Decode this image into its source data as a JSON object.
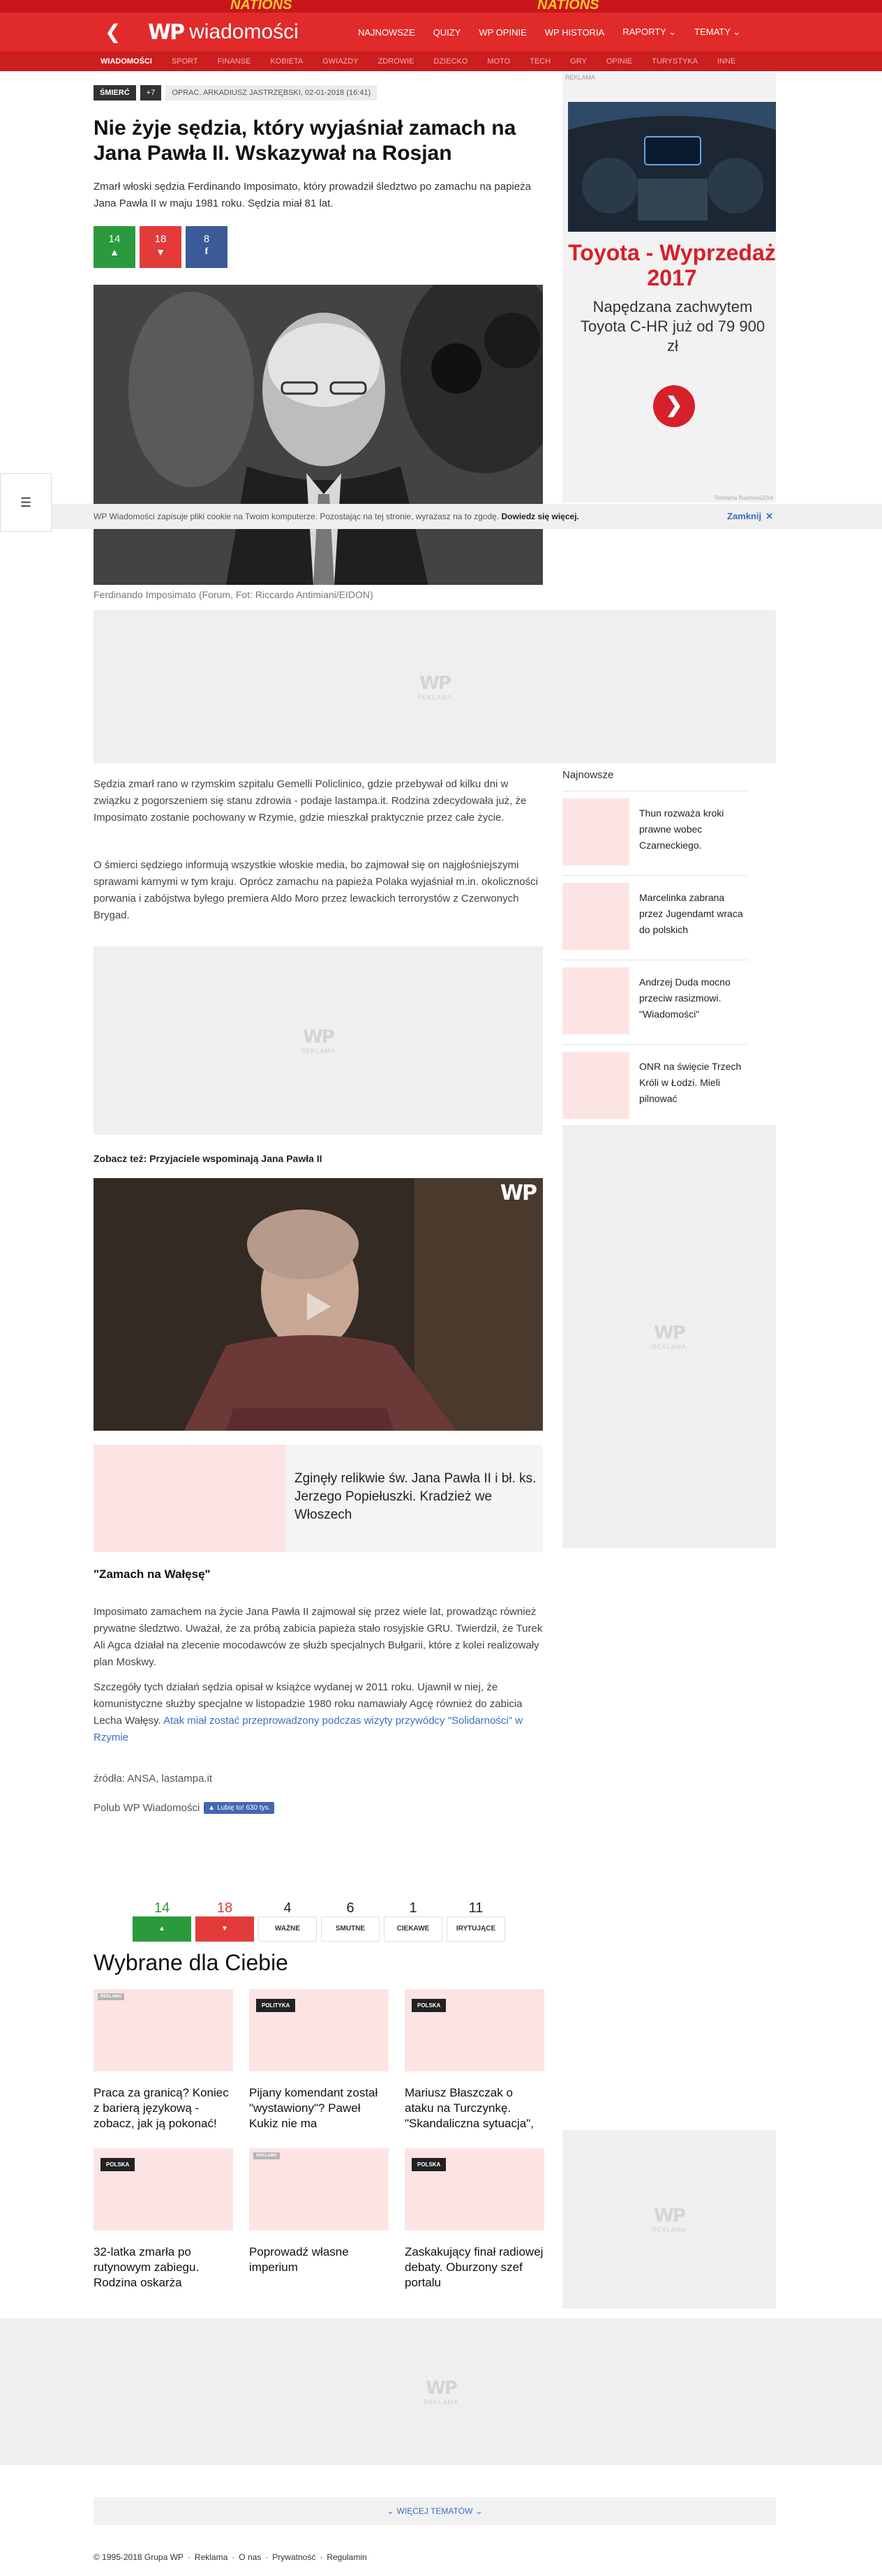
{
  "top_banner": {
    "text_1": "NATIONS",
    "text_2": "NATIONS"
  },
  "nav": {
    "logo_mark": "WP",
    "logo_text": "wiadomości",
    "links": [
      "NAJNOWSZE",
      "QUIZY",
      "WP OPINIE",
      "WP HISTORIA",
      "RAPORTY",
      "TEMATY"
    ]
  },
  "subnav": [
    "WIADOMOŚCI",
    "SPORT",
    "FINANSE",
    "KOBIETA",
    "GWIAZDY",
    "ZDROWIE",
    "DZIECKO",
    "MOTO",
    "TECH",
    "GRY",
    "OPINIE",
    "TURYSTYKA",
    "INNE"
  ],
  "article": {
    "tag": "ŚMIERĆ",
    "tag_more": "+7",
    "byline": "OPRAC. ARKADIUSZ JASTRZĘBSKI, 02-01-2018 (16:41)",
    "title": "Nie żyje sędzia, który wyjaśniał zamach na Jana Pawła II. Wskazywał na Rosjan",
    "lead": "Zmarł włoski sędzia Ferdinando Imposimato, który prowadził śledztwo po zamachu na papieża Jana Pawła II w maju 1981 roku. Sędzia miał 81 lat.",
    "votes": {
      "up": "14",
      "down": "18",
      "fb": "8"
    },
    "photo_caption": "Ferdinando Imposimato (Forum, Fot: Riccardo Antimiani/EIDON)",
    "p1": "Sędzia zmarł rano w rzymskim szpitalu Gemelli Policlinico, gdzie przebywał od kilku dni w związku z pogorszeniem się stanu zdrowia - podaje lastampa.it. Rodzina zdecydowała już, że Imposimato zostanie pochowany w Rzymie, gdzie mieszkał praktycznie przez całe życie.",
    "p2": "O śmierci sędziego informują wszystkie włoskie media, bo zajmował się on najgłośniejszymi sprawami karnymi w tym kraju. Oprócz zamachu na papieża Polaka wyjaśniał m.in. okoliczności porwania i zabójstwa byłego premiera Aldo Moro przez lewackich terrorystów z Czerwonych Brygad.",
    "see_also": "Zobacz też: Przyjaciele wspominają Jana Pawła II",
    "related_title": "Zginęły relikwie św. Jana Pawła II i bł. ks. Jerzego Popiełuszki. Kradzież we Włoszech",
    "h2": "\"Zamach na Wałęsę\"",
    "p3": "Imposimato zamachem na życie Jana Pawła II zajmował się przez wiele lat, prowadząc również prywatne śledztwo. Uważał, że za próbą zabicia papieża stało rosyjskie GRU. Twierdził, że Turek Ali Agca działał na zlecenie mocodawców ze służb specjalnych Bułgarii, które z kolei realizowały plan Moskwy.",
    "p4": "Szczegóły tych działań sędzia opisał w książce wydanej w 2011 roku. Ujawnił w niej, że komunistyczne służby specjalne w listopadzie 1980 roku namawiały Agcę również do zabicia Lecha Wałęsy.",
    "p4_link": "Atak miał zostać przeprowadzony podczas wizyty przywódcy \"Solidarności\" w Rzymie",
    "sources": "źródła: ANSA, lastampa.it",
    "like_label": "Polub WP Wiadomości",
    "like_button": "Lubię to! 630 tys."
  },
  "ad_label": "REKLAMA",
  "ad_logo": "WP",
  "side_ad": {
    "label": "REKLAMA",
    "title": "Toyota - Wyprzedaż 2017",
    "subtitle": "Napędzana zachwytem Toyota C-HR już od 79 900 zł",
    "footnote": "Reklama Business2Dot"
  },
  "cookie": {
    "text": "WP Wiadomości zapisuje pliki cookie na Twoim komputerze. Pozostając na tej stronie, wyrażasz na to zgodę.",
    "link": "Dowiedz się więcej.",
    "close": "Zamknij"
  },
  "sidebar": {
    "heading": "Najnowsze",
    "items": [
      "Thun rozważa kroki prawne wobec Czarneckiego.",
      "Marcelinka zabrana przez Jugendamt wraca do polskich",
      "Andrzej Duda mocno przeciw rasizmowi. \"Wiadomości\"",
      "ONR na święcie Trzech Króli w Łodzi. Mieli pilnować"
    ]
  },
  "reactions": [
    {
      "count": "14",
      "label": ""
    },
    {
      "count": "18",
      "label": ""
    },
    {
      "count": "4",
      "label": "WAŻNE"
    },
    {
      "count": "6",
      "label": "SMUTNE"
    },
    {
      "count": "1",
      "label": "CIEKAWE"
    },
    {
      "count": "11",
      "label": "IRYTUJĄCE"
    }
  ],
  "recommended": {
    "heading": "Wybrane dla Ciebie",
    "items": [
      {
        "tag": "REKLAMA",
        "title": "Praca za granicą? Koniec z barierą językową - zobacz, jak ją pokonać!"
      },
      {
        "tag": "POLITYKA",
        "title": "Pijany komendant został \"wystawiony\"? Paweł Kukiz nie ma"
      },
      {
        "tag": "POLSKA",
        "title": "Mariusz Błaszczak o ataku na Turczynkę. \"Skandaliczna sytuacja\","
      },
      {
        "tag": "POLSKA",
        "title": "32-latka zmarła po rutynowym zabiegu. Rodzina oskarża"
      },
      {
        "tag": "REKLAMA",
        "title": "Poprowadź własne imperium"
      },
      {
        "tag": "POLSKA",
        "title": "Zaskakujący finał radiowej debaty. Oburzony szef portalu"
      }
    ]
  },
  "more_topics": "WIĘCEJ TEMATÓW",
  "footer": {
    "copyright": "© 1995-2018 Grupa WP",
    "links": [
      "Reklama",
      "O nas",
      "Prywatność",
      "Regulamin"
    ]
  },
  "colors": {
    "brand_red": "#e12b2b",
    "vote_green": "#2a9a3c",
    "vote_red": "#e33a3a",
    "fb_blue": "#3d5a98",
    "link_blue": "#3a6fc1"
  }
}
